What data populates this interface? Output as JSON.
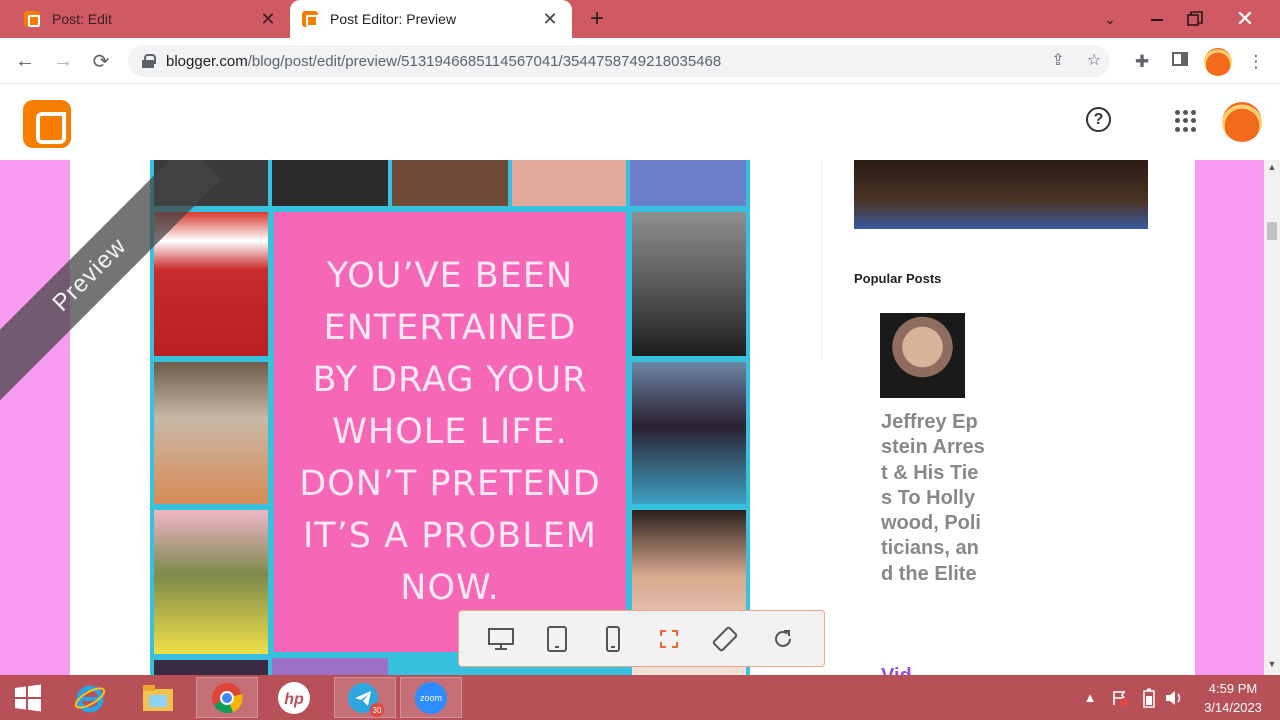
{
  "browser": {
    "tabs": [
      {
        "title": "Post: Edit",
        "active": false
      },
      {
        "title": "Post Editor: Preview",
        "active": true
      }
    ],
    "url_domain": "blogger.com",
    "url_path": "/blog/post/edit/preview/5131946685114567041/3544758749218035468"
  },
  "preview": {
    "ribbon_label": "Preview",
    "quote_lines": [
      "YOU’VE BEEN",
      "ENTERTAINED",
      "BY DRAG YOUR",
      "WHOLE LIFE.",
      "DON’T PRETEND",
      "IT’S A PROBLEM",
      "NOW."
    ]
  },
  "sidebar": {
    "popular_title": "Popular Posts",
    "popular_post_title": "Jeffrey Epstein Arrest & His Ties To Hollywood, Politicians, and the Elite",
    "popular_post_more": "Vid"
  },
  "taskbar": {
    "telegram_badge": "30",
    "zoom_label": "zoom",
    "time": "4:59 PM",
    "date": "3/14/2023"
  },
  "colors": {
    "tab_strip": "#cf5a63",
    "preview_bg": "#f79bf0",
    "quote_panel": "#f767b8",
    "collage_border": "#36c1de",
    "blogger_orange": "#f57d00",
    "taskbar": "#b85058"
  }
}
